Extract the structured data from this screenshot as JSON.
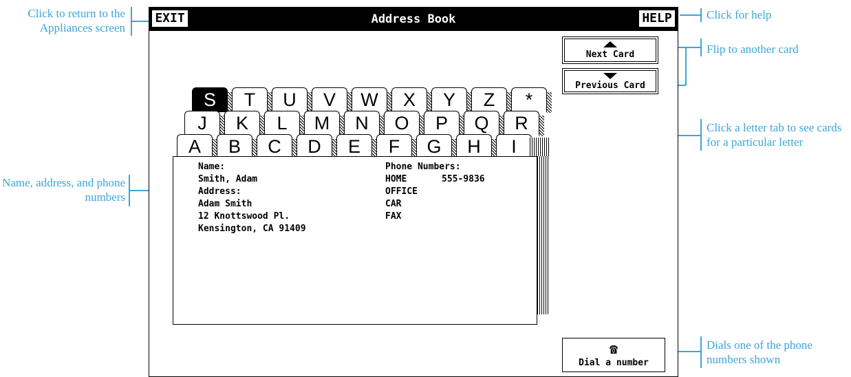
{
  "window": {
    "title": "Address Book"
  },
  "toolbar": {
    "exit_label": "EXIT",
    "help_label": "HELP"
  },
  "nav": {
    "next_label": "Next Card",
    "previous_label": "Previous Card"
  },
  "tabs": {
    "row1": [
      "S",
      "T",
      "U",
      "V",
      "W",
      "X",
      "Y",
      "Z",
      "*"
    ],
    "row2": [
      "J",
      "K",
      "L",
      "M",
      "N",
      "O",
      "P",
      "Q",
      "R"
    ],
    "row3": [
      "A",
      "B",
      "C",
      "D",
      "E",
      "F",
      "G",
      "H",
      "I"
    ],
    "active": "S"
  },
  "card": {
    "name_label": "Name:",
    "name_value": "Smith, Adam",
    "address_label": "Address:",
    "address_lines": [
      "Adam Smith",
      "12 Knottswood Pl.",
      "Kensington, CA 91409"
    ],
    "phone_label": "Phone Numbers:",
    "phones": [
      {
        "type": "HOME",
        "number": "555-9836"
      },
      {
        "type": "OFFICE",
        "number": ""
      },
      {
        "type": "CAR",
        "number": ""
      },
      {
        "type": "FAX",
        "number": ""
      }
    ]
  },
  "dial": {
    "label": "Dial a number",
    "icon": "telephone-icon"
  },
  "callouts": {
    "exit": "Click to return to the Appliances screen",
    "help": "Click for help",
    "flip": "Flip to another card",
    "tabs": "Click a letter tab to see cards for a particular letter",
    "name": "Name, address, and phone numbers",
    "dial": "Dials one of the phone numbers shown"
  },
  "colors": {
    "callout": "#3aa6d8"
  }
}
